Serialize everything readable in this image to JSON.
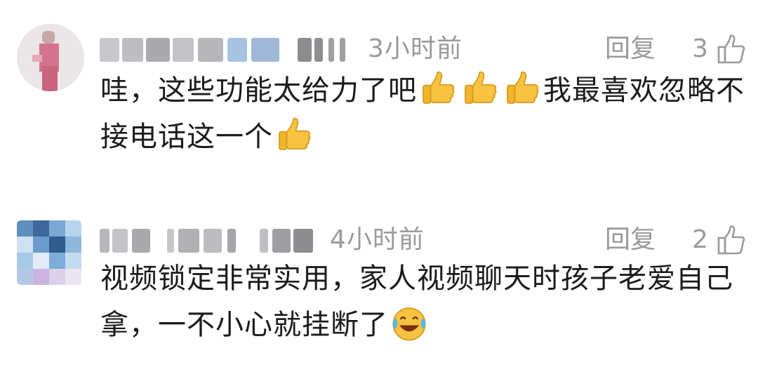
{
  "comments": [
    {
      "time": "3小时前",
      "reply_label": "回复",
      "likes": "3",
      "text_before": "哇，这些功能太给力了吧",
      "text_after": "我最喜欢忽略不接电话这一个",
      "emojis": [
        "thumbs-up-emoji",
        "thumbs-up-emoji",
        "thumbs-up-emoji",
        "thumbs-up-emoji"
      ]
    },
    {
      "time": "4小时前",
      "reply_label": "回复",
      "likes": "2",
      "text": "视频锁定非常实用，家人视频聊天时孩子老爱自己拿，一不小心就挂断了",
      "emojis": [
        "crying-laughing-emoji"
      ]
    }
  ],
  "colors": {
    "meta_gray": "#9a9a9a",
    "text": "#1b1b1b",
    "emoji_yellow": "#f7c340"
  }
}
